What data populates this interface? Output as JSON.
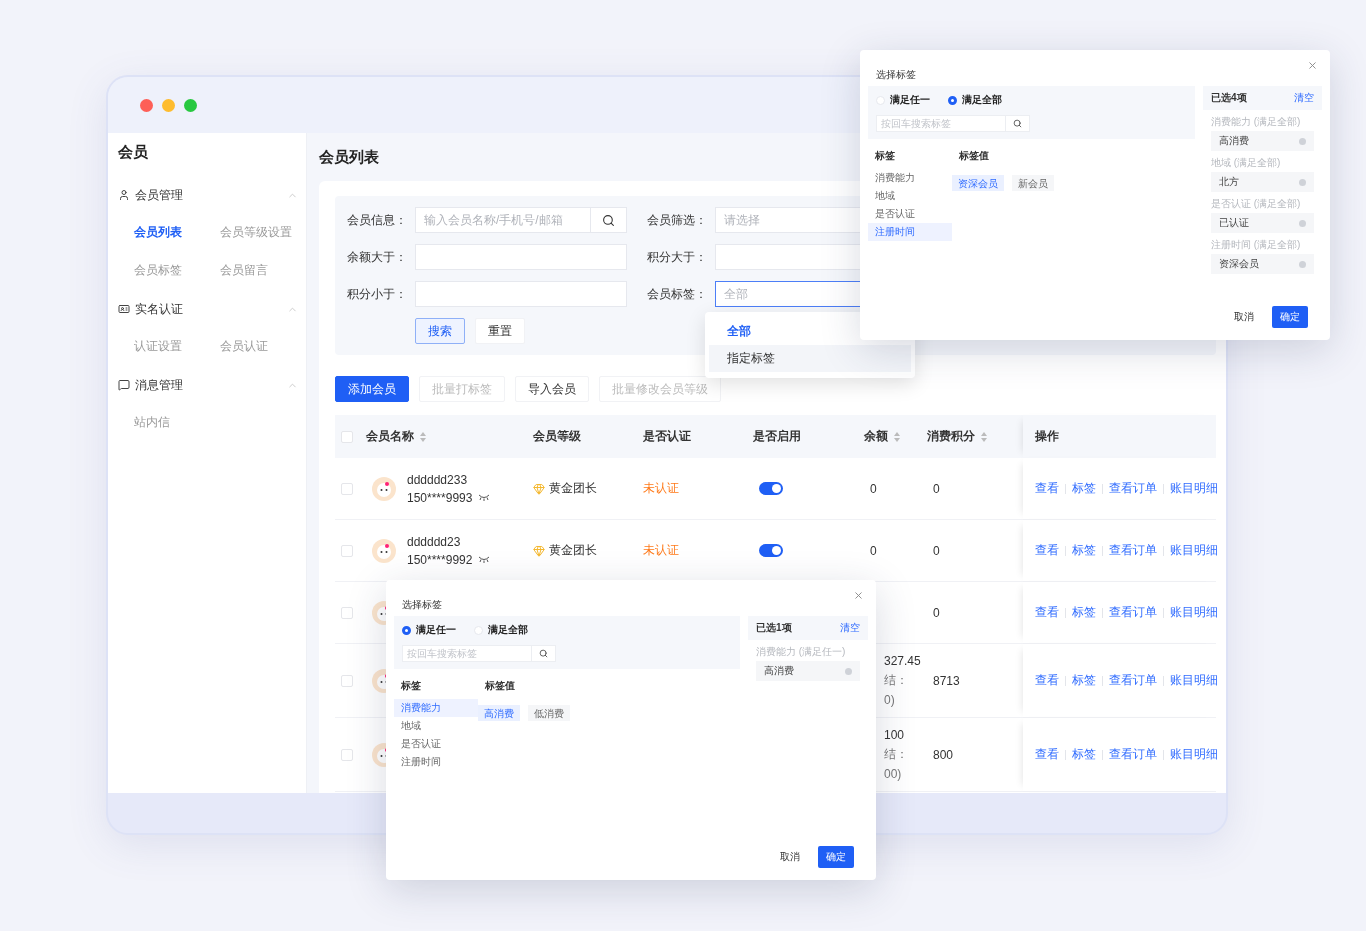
{
  "sidebar": {
    "title": "会员",
    "groups": [
      {
        "label": "会员管理",
        "expanded": true,
        "items": [
          {
            "label": "会员列表",
            "selected": true
          },
          {
            "label": "会员等级设置",
            "selected": false
          },
          {
            "label": "会员标签",
            "selected": false
          },
          {
            "label": "会员留言",
            "selected": false
          }
        ]
      },
      {
        "label": "实名认证",
        "expanded": true,
        "items": [
          {
            "label": "认证设置",
            "selected": false
          },
          {
            "label": "会员认证",
            "selected": false
          }
        ]
      },
      {
        "label": "消息管理",
        "expanded": true,
        "items": [
          {
            "label": "站内信",
            "selected": false
          }
        ]
      }
    ]
  },
  "page_title": "会员列表",
  "filters": [
    {
      "label": "会员信息：",
      "placeholder": "输入会员名称/手机号/邮箱",
      "kind": "search",
      "focused": false
    },
    {
      "label": "会员筛选：",
      "placeholder": "请选择",
      "kind": "select",
      "focused": false
    },
    {
      "label": "余额大于：",
      "kind": "text",
      "focused": false
    },
    {
      "label": "积分大于：",
      "kind": "text",
      "focused": false
    },
    {
      "label": "积分小于：",
      "kind": "text",
      "focused": false
    },
    {
      "label": "会员标签：",
      "placeholder": "全部",
      "kind": "select",
      "focused": true
    }
  ],
  "filter_buttons": [
    {
      "label": "搜索",
      "kind": "primary"
    },
    {
      "label": "重置",
      "kind": "default"
    }
  ],
  "dropdown": {
    "options": [
      {
        "label": "全部",
        "selected": true,
        "hovered": false
      },
      {
        "label": "指定标签",
        "selected": false,
        "hovered": true
      }
    ]
  },
  "toolbar": [
    {
      "label": "添加会员",
      "kind": "primary",
      "disabled": false
    },
    {
      "label": "批量打标签",
      "kind": "default",
      "disabled": true
    },
    {
      "label": "导入会员",
      "kind": "default",
      "disabled": false
    },
    {
      "label": "批量修改会员等级",
      "kind": "default",
      "disabled": true
    }
  ],
  "table": {
    "header_checked": false,
    "columns": [
      {
        "label": "会员名称",
        "sortable": true
      },
      {
        "label": "会员等级",
        "sortable": false
      },
      {
        "label": "是否认证",
        "sortable": false
      },
      {
        "label": "是否启用",
        "sortable": false
      },
      {
        "label": "余额",
        "sortable": true
      },
      {
        "label": "消费积分",
        "sortable": true
      },
      {
        "label": "操作",
        "sortable": false
      }
    ],
    "rows": [
      {
        "checked": false,
        "name": "dddddd233",
        "phone": "150****9993",
        "level": "黄金团长",
        "auth": "未认证",
        "auth_ok": false,
        "enabled": true,
        "balance": [
          "0"
        ],
        "points": "0",
        "actions": [
          "查看",
          "标签",
          "查看订单",
          "账目明细"
        ]
      },
      {
        "checked": false,
        "name": "dddddd23",
        "phone": "150****9992",
        "level": "黄金团长",
        "auth": "未认证",
        "auth_ok": false,
        "enabled": true,
        "balance": [
          "0"
        ],
        "points": "0",
        "actions": [
          "查看",
          "标签",
          "查看订单",
          "账目明细"
        ]
      },
      {
        "checked": false,
        "points": "0",
        "actions": [
          "查看",
          "标签",
          "查看订单",
          "账目明细"
        ]
      },
      {
        "checked": false,
        "balance": [
          "327.45",
          "结：",
          "0)"
        ],
        "points": "8713",
        "actions": [
          "查看",
          "标签",
          "查看订单",
          "账目明细"
        ]
      },
      {
        "checked": false,
        "balance": [
          "100",
          "结：",
          "00)"
        ],
        "points": "800",
        "actions": [
          "查看",
          "标签",
          "查看订单",
          "账目明细"
        ]
      }
    ]
  },
  "dialogs": [
    {
      "title": "选择标签",
      "match_options": [
        {
          "label": "满足任一",
          "selected": false
        },
        {
          "label": "满足全部",
          "selected": true
        }
      ],
      "search_placeholder": "按回车搜索标签",
      "tag_header": "标签",
      "value_header": "标签值",
      "tags": [
        {
          "label": "消费能力",
          "selected": false
        },
        {
          "label": "地域",
          "selected": false
        },
        {
          "label": "是否认证",
          "selected": false
        },
        {
          "label": "注册时间",
          "selected": true
        }
      ],
      "values": [
        {
          "label": "资深会员",
          "selected": true
        },
        {
          "label": "新会员",
          "selected": false
        }
      ],
      "summary": "已选4项",
      "clear": "清空",
      "groups": [
        {
          "label": "消费能力 (满足全部)",
          "value": "高消费"
        },
        {
          "label": "地域 (满足全部)",
          "value": "北方"
        },
        {
          "label": "是否认证 (满足全部)",
          "value": "已认证"
        },
        {
          "label": "注册时间 (满足全部)",
          "value": "资深会员"
        }
      ],
      "cancel": "取消",
      "confirm": "确定"
    },
    {
      "title": "选择标签",
      "match_options": [
        {
          "label": "满足任一",
          "selected": true
        },
        {
          "label": "满足全部",
          "selected": false
        }
      ],
      "search_placeholder": "按回车搜索标签",
      "tag_header": "标签",
      "value_header": "标签值",
      "tags": [
        {
          "label": "消费能力",
          "selected": true
        },
        {
          "label": "地域",
          "selected": false
        },
        {
          "label": "是否认证",
          "selected": false
        },
        {
          "label": "注册时间",
          "selected": false
        }
      ],
      "values": [
        {
          "label": "高消费",
          "selected": true
        },
        {
          "label": "低消费",
          "selected": false
        }
      ],
      "summary": "已选1项",
      "clear": "清空",
      "groups": [
        {
          "label": "消费能力 (满足任一)",
          "value": "高消费"
        }
      ],
      "cancel": "取消",
      "confirm": "确定"
    }
  ]
}
